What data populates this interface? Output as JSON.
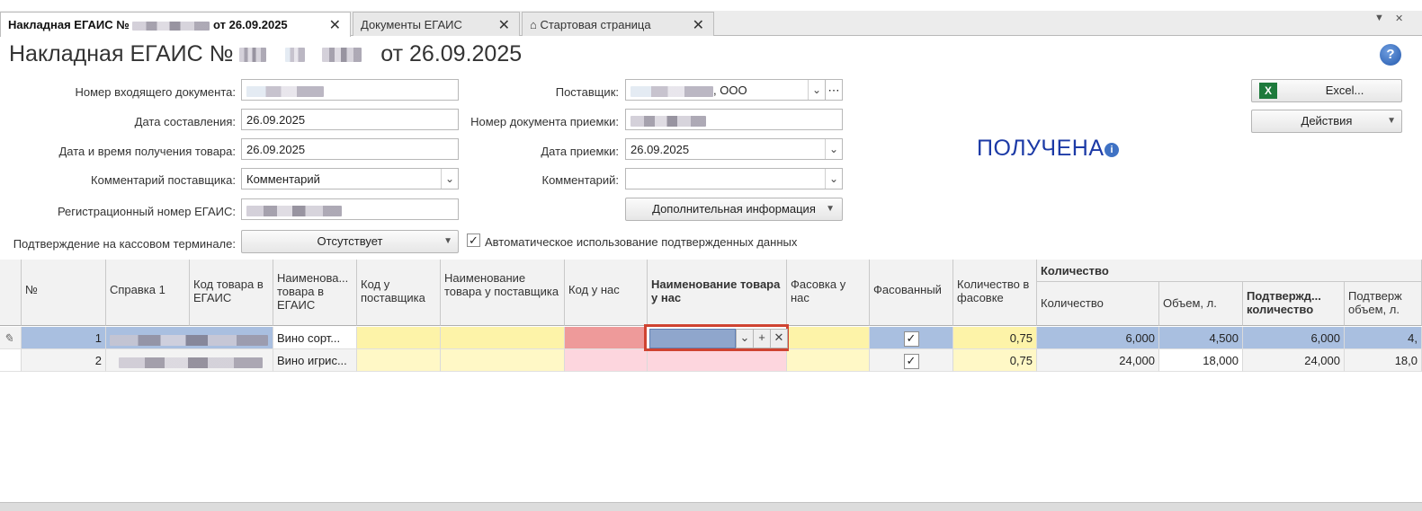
{
  "tabs": [
    {
      "label": "Накладная ЕГАИС №",
      "suffix": " от 26.09.2025",
      "active": true
    },
    {
      "label": "Документы ЕГАИС"
    },
    {
      "label": "Стартовая страница"
    }
  ],
  "header": {
    "title_prefix": "Накладная ЕГАИС №",
    "title_suffix": "от 26.09.2025",
    "status": "ПОЛУЧЕНА"
  },
  "form": {
    "incoming_doc_label": "Номер входящего документа:",
    "created_date_label": "Дата составления:",
    "created_date_value": "26.09.2025",
    "received_dt_label": "Дата и время получения товара:",
    "received_dt_value": "26.09.2025",
    "supplier_comment_label": "Комментарий поставщика:",
    "supplier_comment_value": "Комментарий",
    "egais_reg_label": "Регистрационный номер ЕГАИС:",
    "pos_confirm_label": "Подтверждение на кассовом терминале:",
    "pos_confirm_value": "Отсутствует",
    "supplier_label": "Поставщик:",
    "supplier_value_suffix": ", ООО",
    "acceptance_doc_label": "Номер документа приемки:",
    "acceptance_date_label": "Дата приемки:",
    "acceptance_date_value": "26.09.2025",
    "comment_label": "Комментарий:",
    "additional_info_btn": "Дополнительная информация",
    "auto_use_label": "Автоматическое использование подтвержденных данных"
  },
  "actions": {
    "excel": "Excel...",
    "actions": "Действия"
  },
  "table": {
    "headers": {
      "no": "№",
      "cert": "Справка 1",
      "egais_code": "Код товара в ЕГАИС",
      "egais_name": "Наименова... товара в ЕГАИС",
      "supplier_code": "Код у поставщика",
      "supplier_name": "Наименование товара у поставщика",
      "our_code": "Код у нас",
      "our_name": "Наименование товара у нас",
      "our_pack": "Фасовка у нас",
      "packed": "Фасованный",
      "qty_in_pack": "Количество в фасовке",
      "qty_group": "Количество",
      "qty": "Количество",
      "volume": "Объем, л.",
      "confirmed_qty": "Подтвержд... количество",
      "confirmed_vol": "Подтверж объем, л."
    },
    "rows": [
      {
        "no": "1",
        "egais_name": "Вино сорт...",
        "qty_in_pack": "0,75",
        "qty": "6,000",
        "volume": "4,500",
        "confirmed_qty": "6,000",
        "confirmed_vol": "4,"
      },
      {
        "no": "2",
        "egais_name": "Вино игрис...",
        "qty_in_pack": "0,75",
        "qty": "24,000",
        "volume": "18,000",
        "confirmed_qty": "24,000",
        "confirmed_vol": "18,0"
      }
    ]
  },
  "colors": {
    "status": "#1c3aa6",
    "selected_row": "#a9bfe0",
    "editor_border": "#cf4331"
  }
}
